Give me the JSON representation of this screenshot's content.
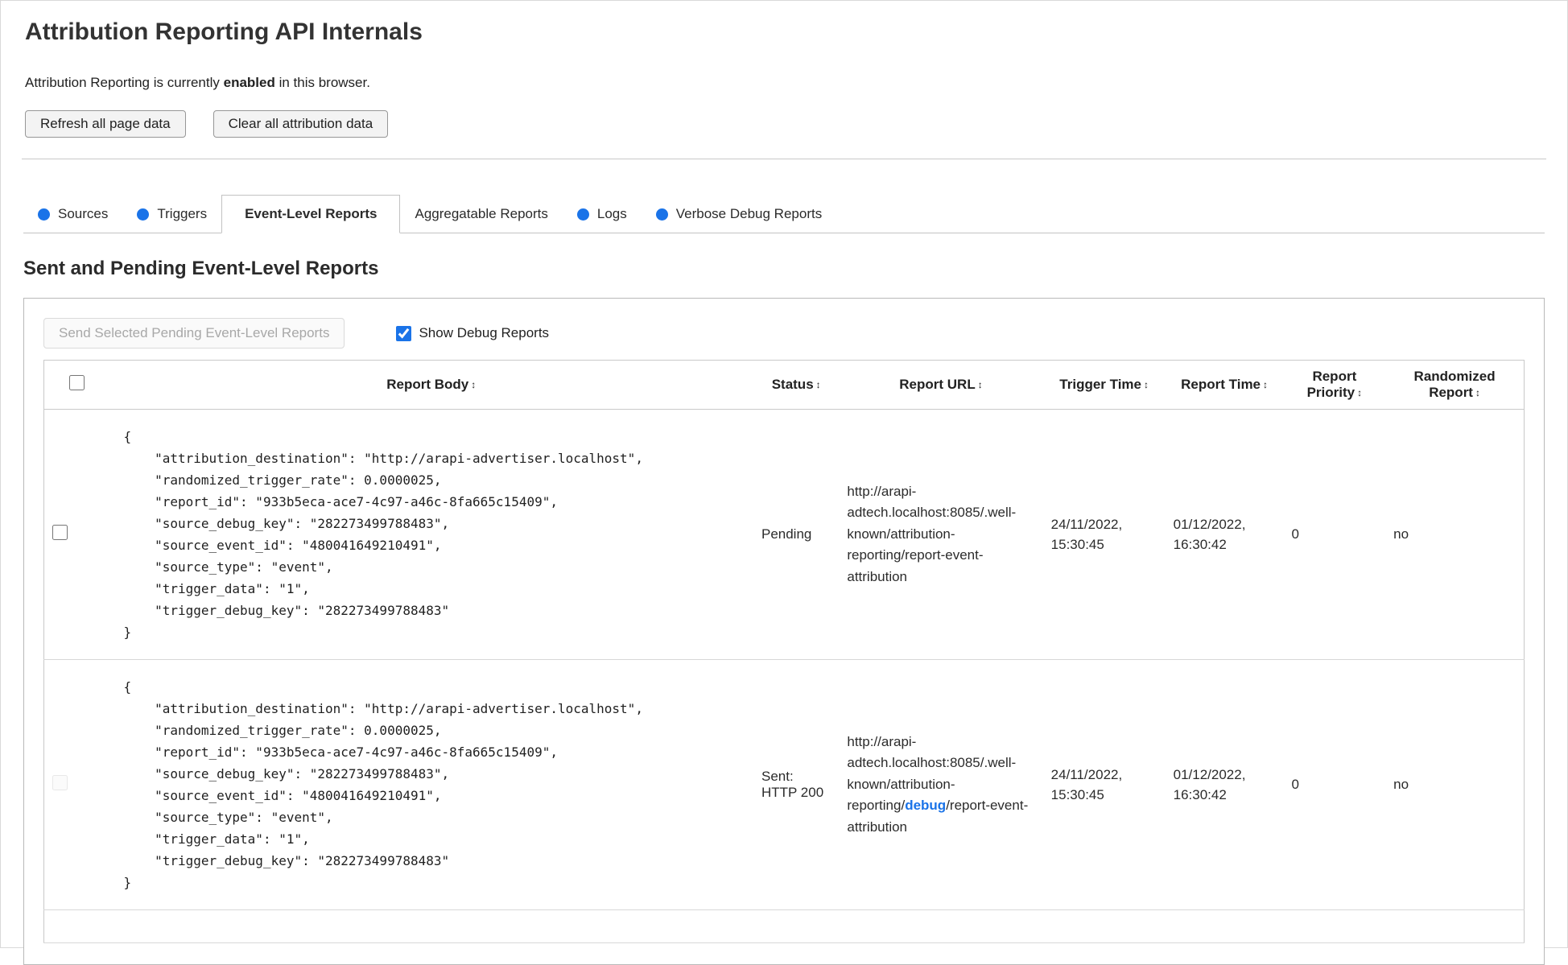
{
  "colors": {
    "accent_blue": "#1a73e8"
  },
  "header": {
    "title": "Attribution Reporting API Internals",
    "status": {
      "prefix": "Attribution Reporting is currently ",
      "bold": "enabled",
      "suffix": " in this browser."
    },
    "buttons": {
      "refresh": "Refresh all page data",
      "clear": "Clear all attribution data"
    }
  },
  "tabs": [
    {
      "label": "Sources",
      "dot": true,
      "active": false
    },
    {
      "label": "Triggers",
      "dot": true,
      "active": false
    },
    {
      "label": "Event-Level Reports",
      "dot": false,
      "active": true
    },
    {
      "label": "Aggregatable Reports",
      "dot": false,
      "active": false
    },
    {
      "label": "Logs",
      "dot": true,
      "active": false
    },
    {
      "label": "Verbose Debug Reports",
      "dot": true,
      "active": false
    }
  ],
  "section": {
    "heading": "Sent and Pending Event-Level Reports"
  },
  "controls": {
    "send_button": {
      "label": "Send Selected Pending Event-Level Reports",
      "disabled": true
    },
    "show_debug": {
      "label": "Show Debug Reports",
      "checked": true
    }
  },
  "table": {
    "sort_icon": "↕",
    "select_all": {
      "checked": false,
      "disabled": false
    },
    "headers": [
      "Report Body",
      "Status",
      "Report URL",
      "Trigger Time",
      "Report Time",
      "Report Priority",
      "Randomized Report"
    ],
    "rows": [
      {
        "checkbox": {
          "checked": false,
          "disabled": false
        },
        "report_body": "{\n    \"attribution_destination\": \"http://arapi-advertiser.localhost\",\n    \"randomized_trigger_rate\": 0.0000025,\n    \"report_id\": \"933b5eca-ace7-4c97-a46c-8fa665c15409\",\n    \"source_debug_key\": \"282273499788483\",\n    \"source_event_id\": \"480041649210491\",\n    \"source_type\": \"event\",\n    \"trigger_data\": \"1\",\n    \"trigger_debug_key\": \"282273499788483\"\n}",
        "status": "Pending",
        "url": {
          "prefix": "http://arapi-adtech.localhost:8085/.well-known/attribution-reporting/report-event-attribution",
          "link": "",
          "suffix": ""
        },
        "trigger_time": "24/11/2022, 15:30:45",
        "report_time": "01/12/2022, 16:30:42",
        "priority": "0",
        "randomized": "no"
      },
      {
        "checkbox": {
          "checked": false,
          "disabled": true
        },
        "report_body": "{\n    \"attribution_destination\": \"http://arapi-advertiser.localhost\",\n    \"randomized_trigger_rate\": 0.0000025,\n    \"report_id\": \"933b5eca-ace7-4c97-a46c-8fa665c15409\",\n    \"source_debug_key\": \"282273499788483\",\n    \"source_event_id\": \"480041649210491\",\n    \"source_type\": \"event\",\n    \"trigger_data\": \"1\",\n    \"trigger_debug_key\": \"282273499788483\"\n}",
        "status": "Sent: HTTP 200",
        "url": {
          "prefix": "http://arapi-adtech.localhost:8085/.well-known/attribution-reporting/",
          "link": "debug",
          "suffix": "/report-event-attribution"
        },
        "trigger_time": "24/11/2022, 15:30:45",
        "report_time": "01/12/2022, 16:30:42",
        "priority": "0",
        "randomized": "no"
      }
    ]
  }
}
